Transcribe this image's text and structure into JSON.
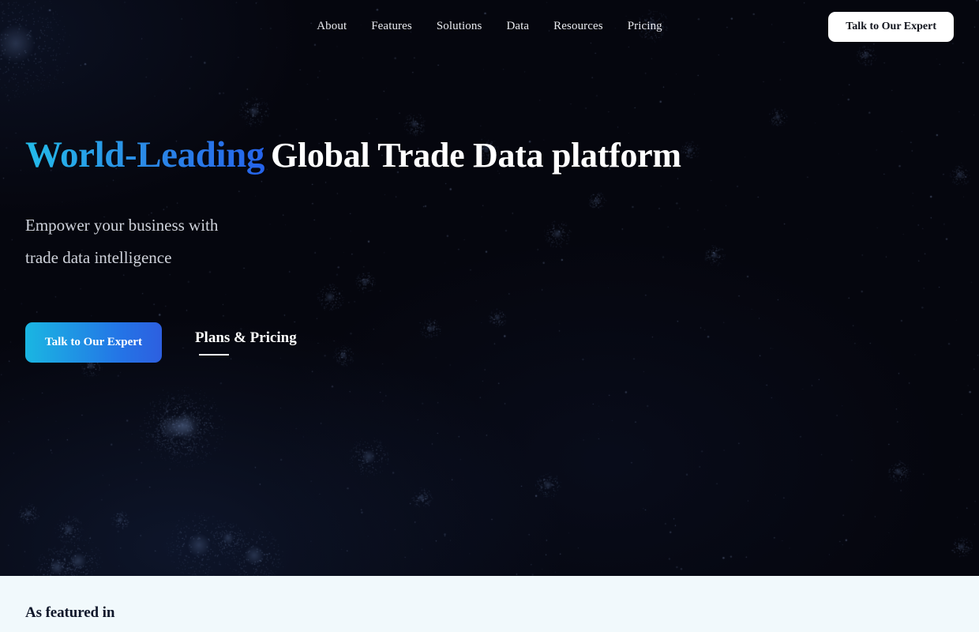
{
  "nav": {
    "links": [
      {
        "label": "About"
      },
      {
        "label": "Features"
      },
      {
        "label": "Solutions"
      },
      {
        "label": "Data"
      },
      {
        "label": "Resources"
      },
      {
        "label": "Pricing"
      }
    ],
    "cta_label": "Talk to Our Expert"
  },
  "hero": {
    "headline_accent": "World-Leading",
    "headline_main": "Global Trade Data platform",
    "subtitle_line1": "Empower your business with",
    "subtitle_line2": "trade data intelligence",
    "primary_cta": "Talk to Our Expert",
    "secondary_cta": "Plans & Pricing"
  },
  "featured": {
    "title": "As featured in"
  },
  "colors": {
    "background": "#05060e",
    "accent_cyan": "#23bbe9",
    "accent_blue": "#2563eb",
    "nav_cta_bg": "#ffffff",
    "featured_bg": "#f1f9fc",
    "featured_text": "#0f172a",
    "subtitle_text": "#cfd2db"
  }
}
